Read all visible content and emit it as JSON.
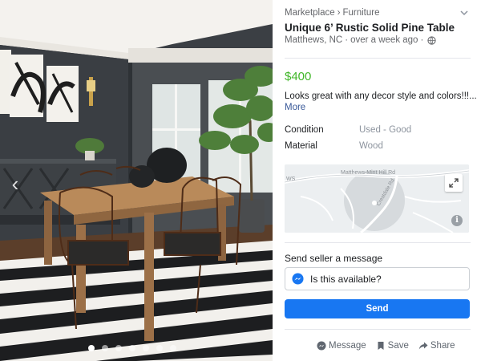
{
  "listing": {
    "breadcrumb": [
      "Marketplace",
      "Furniture"
    ],
    "breadcrumb_separator": "›",
    "title": "Unique 6’ Rustic Solid Pine Table",
    "location": "Matthews, NC",
    "posted": "over a week ago",
    "meta_separator": "·",
    "price": "$400",
    "description": "Looks great with any decor style and colors!!!...",
    "more_label": "More",
    "attributes": [
      {
        "label": "Condition",
        "value": "Used - Good"
      },
      {
        "label": "Material",
        "value": "Wood"
      }
    ]
  },
  "map": {
    "road_labels": [
      "Matthews-Mint Hill Rd",
      "Crestdale Rd",
      "WS"
    ]
  },
  "contact": {
    "heading": "Send seller a message",
    "message_value": "Is this available?",
    "send_label": "Send"
  },
  "actions": [
    {
      "label": "Message",
      "icon": "messenger-icon"
    },
    {
      "label": "Save",
      "icon": "bookmark-icon"
    },
    {
      "label": "Share",
      "icon": "share-icon"
    }
  ],
  "gallery": {
    "photo_count": 7,
    "active_index": 0
  },
  "colors": {
    "price": "#42b72a",
    "send_button": "#1877f2",
    "link": "#385898"
  }
}
